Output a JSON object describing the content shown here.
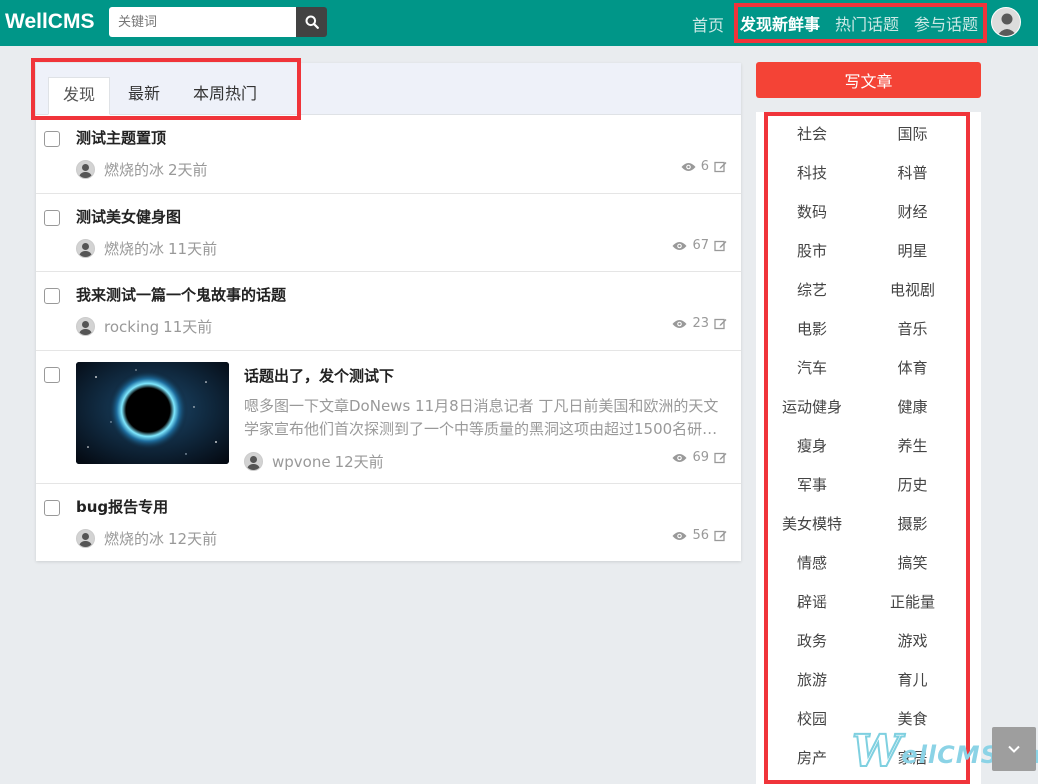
{
  "header": {
    "brand": "WellCMS",
    "search_placeholder": "关键词",
    "nav": {
      "home": "首页",
      "discover": "发现新鲜事",
      "hot_topics": "热门话题",
      "join_topics": "参与话题"
    }
  },
  "tabs": [
    {
      "label": "发现",
      "active": true
    },
    {
      "label": "最新",
      "active": false
    },
    {
      "label": "本周热门",
      "active": false
    }
  ],
  "threads": [
    {
      "title": "测试主题置顶",
      "author": "燃烧的冰",
      "time": "2天前",
      "views": "6"
    },
    {
      "title": "测试美女健身图",
      "author": "燃烧的冰",
      "time": "11天前",
      "views": "67"
    },
    {
      "title": "我来测试一篇一个鬼故事的话题",
      "author": "rocking",
      "time": "11天前",
      "views": "23"
    },
    {
      "title": "话题出了，发个测试下",
      "author": "wpvone",
      "time": "12天前",
      "views": "69",
      "excerpt_line1": "嗯多图一下文章DoNews 11月8日消息记者 丁凡日前美国和欧洲的天文",
      "excerpt_line2": "学家宣布他们首次探测到了一个中等质量的黑洞这项由超过1500名研…"
    },
    {
      "title": "bug报告专用",
      "author": "燃烧的冰",
      "time": "12天前",
      "views": "56"
    }
  ],
  "sidebar": {
    "write_button": "写文章",
    "categories": [
      "社会",
      "国际",
      "科技",
      "科普",
      "数码",
      "财经",
      "股市",
      "明星",
      "综艺",
      "电视剧",
      "电影",
      "音乐",
      "汽车",
      "体育",
      "运动健身",
      "健康",
      "瘦身",
      "养生",
      "军事",
      "历史",
      "美女模特",
      "摄影",
      "情感",
      "搞笑",
      "辟谣",
      "正能量",
      "政务",
      "游戏",
      "旅游",
      "育儿",
      "校园",
      "美食",
      "房产",
      "家居"
    ]
  },
  "watermark": {
    "letter": "W",
    "text": "ellCMS.cn"
  },
  "colors": {
    "header": "#009688",
    "accent": "#f44336",
    "highlight": "#f0343a"
  }
}
